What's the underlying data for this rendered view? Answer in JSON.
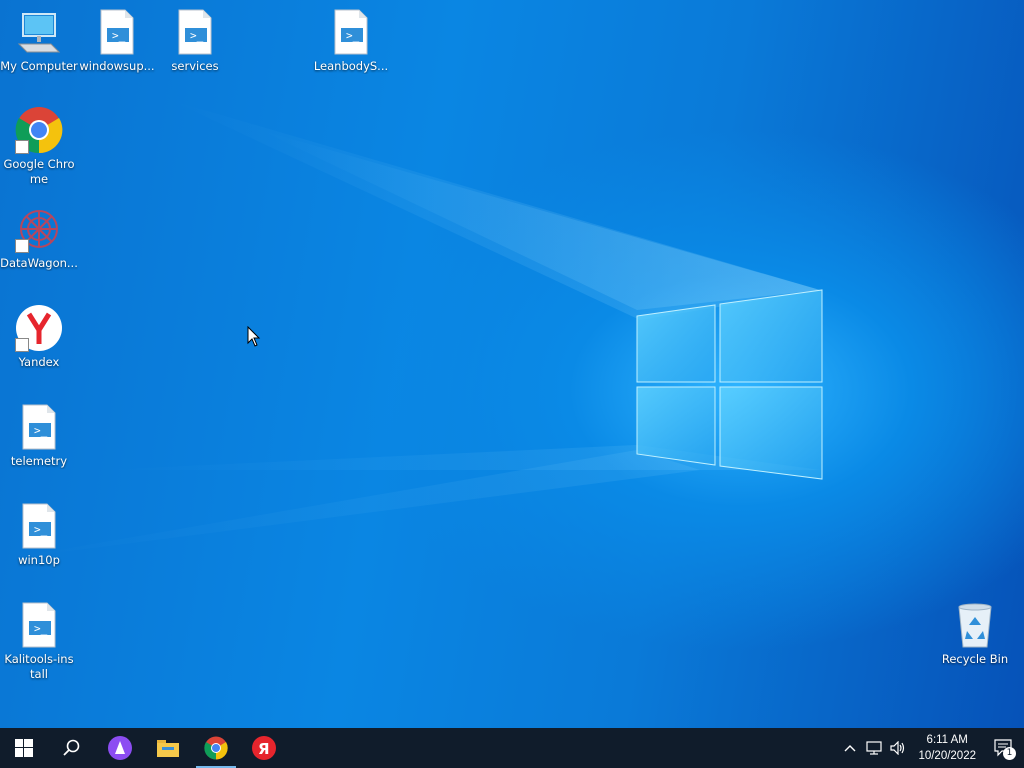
{
  "desktop": {
    "icons": [
      {
        "label": "My Computer",
        "icon": "computer-icon"
      },
      {
        "label": "windowsup...",
        "icon": "script-icon"
      },
      {
        "label": "services",
        "icon": "script-icon"
      },
      {
        "label": "LeanbodyS...",
        "icon": "script-icon"
      },
      {
        "label": "Google Chrome",
        "icon": "chrome-icon"
      },
      {
        "label": "DataWagon...",
        "icon": "datawagon-icon"
      },
      {
        "label": "Yandex",
        "icon": "yandex-icon"
      },
      {
        "label": "telemetry",
        "icon": "script-icon"
      },
      {
        "label": "win10p",
        "icon": "script-icon"
      },
      {
        "label": "Kalitools-install",
        "icon": "script-icon"
      },
      {
        "label": "Recycle Bin",
        "icon": "recycle-bin-icon"
      }
    ]
  },
  "taskbar": {
    "buttons": [
      "start-icon",
      "search-icon",
      "alice-icon",
      "file-explorer-icon",
      "chrome-icon",
      "yandex-icon"
    ],
    "clock": {
      "time": "6:11 AM",
      "date": "10/20/2022"
    },
    "notifications": {
      "count": "1"
    }
  },
  "colors": {
    "taskbar": "#101c2b",
    "accent": "#76b9ed",
    "wallpaper": "#0a7ad8"
  }
}
